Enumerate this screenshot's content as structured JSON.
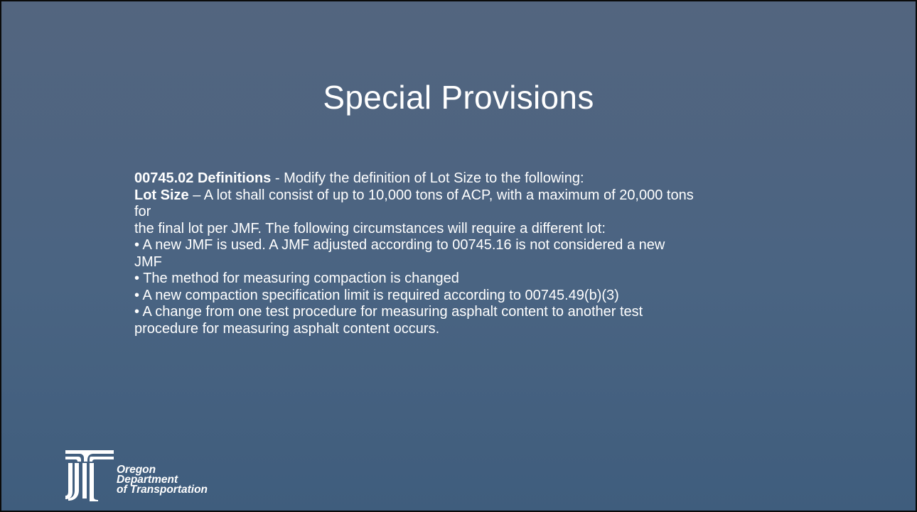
{
  "slide": {
    "title": "Special Provisions",
    "paragraph1_bold": "00745.02 Definitions",
    "paragraph1_rest": " - Modify the definition of Lot Size to the following:",
    "paragraph2_bold": "Lot Size",
    "paragraph2_rest": " – A lot shall consist of up to 10,000 tons of ACP, with a maximum of 20,000 tons",
    "paragraph2_wrap": "for",
    "line3": "the final lot per JMF. The following circumstances will require a different lot:",
    "bullet1_a": "• A new JMF is used. A JMF adjusted according to 00745.16 is not considered a new",
    "bullet1_b": "JMF",
    "bullet2": "• The method for measuring compaction is changed",
    "bullet3": "• A new compaction specification limit is required according to 00745.49(b)(3)",
    "bullet4_a": "• A change from one test procedure for measuring asphalt content to another test",
    "bullet4_b": "procedure for measuring asphalt content occurs."
  },
  "logo": {
    "line1": "Oregon",
    "line2": "Department",
    "line3": "of Transportation",
    "icon": "odot-logo-icon"
  },
  "colors": {
    "background_top": "#53657f",
    "background_bottom": "#3f5d7d",
    "text": "#ffffff",
    "border": "#0b0b0b"
  }
}
